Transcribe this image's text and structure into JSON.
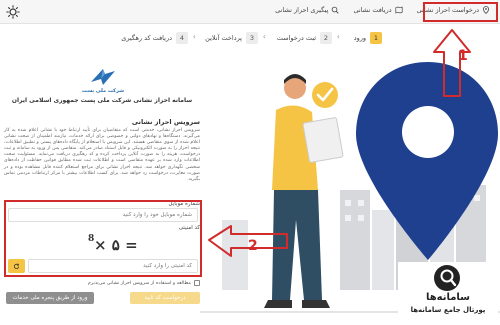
{
  "topnav": {
    "items": [
      {
        "label": "درخواست احراز نشانی",
        "icon": "location-pin-icon"
      },
      {
        "label": "دریافت نشانی",
        "icon": "map-icon"
      },
      {
        "label": "پیگیری احراز نشانی",
        "icon": "tracking-icon"
      }
    ],
    "theme_icon": "sun-icon"
  },
  "steps": [
    {
      "num": "1",
      "label": "ورود",
      "active": true
    },
    {
      "num": "2",
      "label": "ثبت درخواست",
      "active": false
    },
    {
      "num": "3",
      "label": "پرداخت آنلاین",
      "active": false
    },
    {
      "num": "4",
      "label": "دریافت کد رهگیری",
      "active": false
    }
  ],
  "org": {
    "logo_label": "شرکت ملی پست",
    "title": "سامانه احراز نشانی شرکت ملی پست جمهوری اسلامی ایران"
  },
  "section": {
    "title": "سرویس احراز نشانی",
    "description": "سرویس احراز نشانی، خدمتی است که متقاضیان برای تأیید ارتباط خود با نشانی اعلام شده به کار می‌گیرند. دستگاه‌ها و نهادهای دولتی و خصوصی برای ارائه خدمات، نیازمند اطمینان از صحت نشانی اعلام شده از سوی متقاضی هستند. این سرویس با استعلام از پایگاه داده‌های پستی و تطبیق اطلاعات، نتیجه احراز را به صورت الکترونیکی و قابل استناد صادر می‌کند. متقاضی پس از ورود به سامانه و ثبت درخواست، هزینه را به صورت آنلاین پرداخت کرده و کد رهگیری دریافت می‌نماید. مسئولیت صحت اطلاعات وارد شده بر عهده متقاضی است و اطلاعات ثبت شده مطابق قوانین حفاظت از داده‌های شخصی نگهداری خواهد شد. نتیجه احراز نشانی برای مراجع استعلام کننده قابل مشاهده بوده و در صورت مغایرت، درخواست رد خواهد شد. برای کسب اطلاعات بیشتر با مرکز ارتباطات مردمی تماس بگیرید."
  },
  "form": {
    "phone_label": "شماره موبایل",
    "phone_placeholder": "شماره موبایل خود را وارد کنید",
    "captcha_label": "کد امنیتی",
    "captcha_value": "× ۵ =",
    "captcha_sup": "8",
    "captcha_placeholder": "کد امنیتی را وارد کنید",
    "terms_text": "مطالعه و استفاده از سرویس احراز نشانی می‌پذیرم",
    "submit_label": "درخواست کد تایید",
    "gateway_label": "ورود از طریق پنجره ملی خدمات"
  },
  "annotations": {
    "top_marker": "1",
    "form_marker": "2",
    "colors": {
      "annotation": "#d12b2b"
    }
  },
  "brand": {
    "name": "سامانه‌ها",
    "tagline": "پورتال جامع سامانه‌ها"
  },
  "colors": {
    "accent": "#f6c445",
    "pin_blue": "#1f3f8f",
    "muted_gray": "#8f8f8f"
  }
}
